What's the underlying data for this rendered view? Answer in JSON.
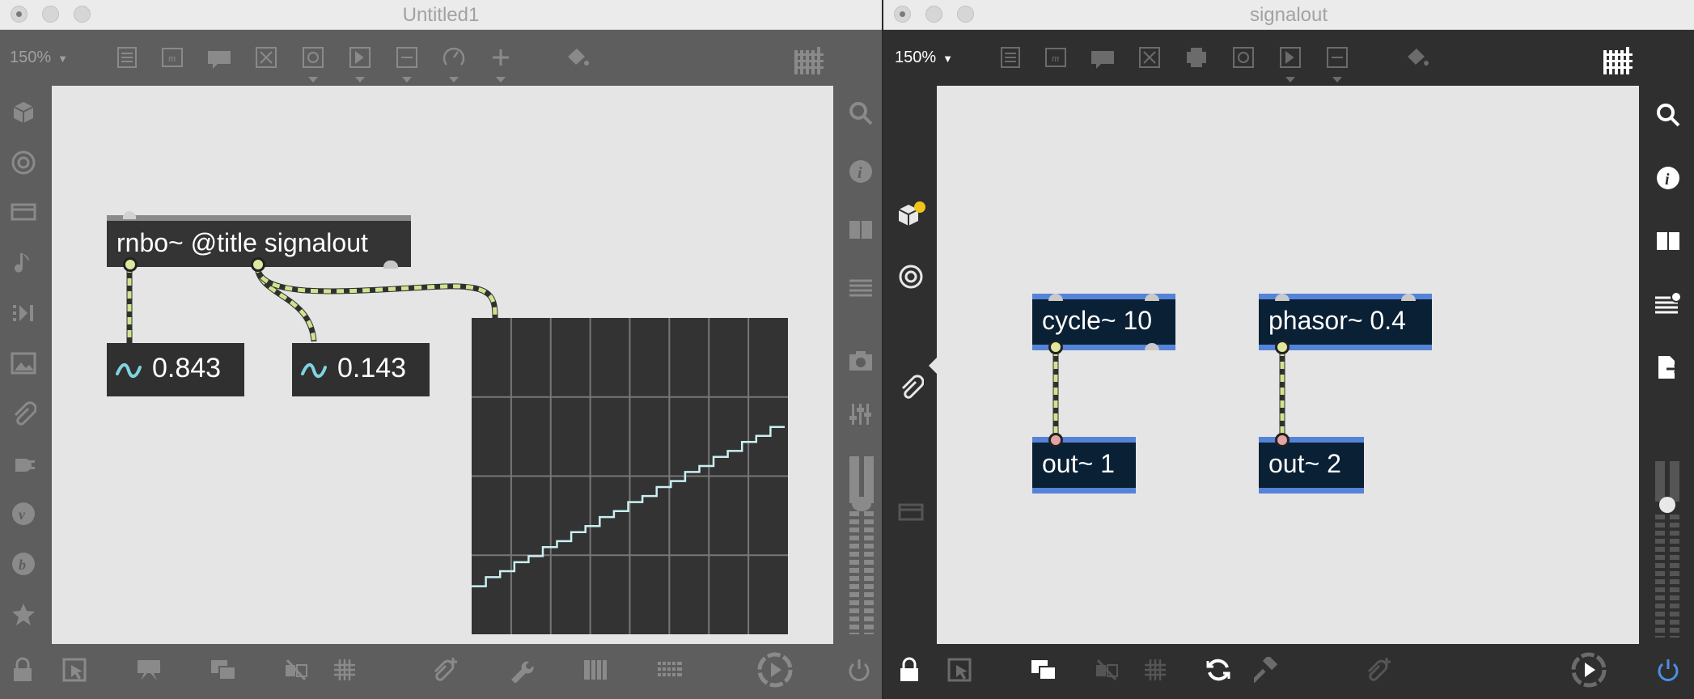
{
  "windows": [
    {
      "title": "Untitled1",
      "zoom": "150%",
      "rnbo_object": "rnbo~ @title signalout",
      "number_boxes": [
        "0.843",
        "0.143"
      ],
      "scope": {
        "type": "line",
        "series": [
          {
            "values": [
              0.16,
              0.19,
              0.21,
              0.24,
              0.26,
              0.29,
              0.31,
              0.34,
              0.36,
              0.39,
              0.41,
              0.44,
              0.46,
              0.49,
              0.51,
              0.54,
              0.56,
              0.59,
              0.61,
              0.64,
              0.66,
              0.69
            ]
          }
        ]
      }
    },
    {
      "title": "signalout",
      "zoom": "150%",
      "objects": [
        "cycle~ 10",
        "phasor~ 0.4",
        "out~ 1",
        "out~ 2"
      ]
    }
  ],
  "colors": {
    "patch_cord": "#cfe48e",
    "signal_cord_dash": "#303030",
    "object_blue": "#5583d8",
    "object_bg": "#0a2035",
    "active_blue": "#4a90e2",
    "notification_dot": "#f0c419",
    "scope_line": "#c9f0f2"
  },
  "icons": [
    "patcher-list-icon",
    "bpatcher-icon",
    "comment-icon",
    "toggle-icon",
    "button-icon",
    "number-icon",
    "slider-icon",
    "dial-icon",
    "add-object-icon",
    "paint-bucket-icon",
    "grid-icon",
    "package-icon",
    "target-icon",
    "media-icon",
    "music-note-icon",
    "sequencer-icon",
    "image-icon",
    "paperclip-icon",
    "plugin-icon",
    "v-icon",
    "b-icon",
    "star-icon",
    "search-icon",
    "info-icon",
    "split-icon",
    "list-icon",
    "camera-icon",
    "mixer-icon",
    "lock-icon",
    "presentation-icon",
    "chat-icon",
    "layers-icon",
    "debug-icon",
    "hash-grid-icon",
    "pin-add-icon",
    "wrench-icon",
    "piano-icon",
    "keyboard-icon",
    "audio-on-icon",
    "power-icon",
    "refresh-icon",
    "hammer-icon",
    "export-icon"
  ]
}
